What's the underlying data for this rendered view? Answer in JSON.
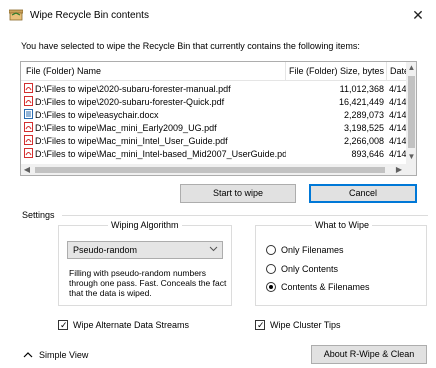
{
  "window": {
    "title": "Wipe Recycle Bin contents",
    "close_glyph": "✕"
  },
  "intro_text": "You have selected to wipe the Recycle Bin that currently contains the following items:",
  "list": {
    "columns": [
      "File (Folder) Name",
      "File (Folder) Size, bytes",
      "Date ."
    ],
    "rows": [
      {
        "name": "D:\\Files to wipe\\2020-subaru-forester-manual.pdf",
        "size": "11,012,368",
        "date": "4/14",
        "icon": "pdf-file-icon"
      },
      {
        "name": "D:\\Files to wipe\\2020-subaru-forester-Quick.pdf",
        "size": "16,421,449",
        "date": "4/14",
        "icon": "pdf-file-icon"
      },
      {
        "name": "D:\\Files to wipe\\easychair.docx",
        "size": "2,289,073",
        "date": "4/14",
        "icon": "docx-file-icon"
      },
      {
        "name": "D:\\Files to wipe\\Mac_mini_Early2009_UG.pdf",
        "size": "3,198,525",
        "date": "4/14",
        "icon": "pdf-file-icon"
      },
      {
        "name": "D:\\Files to wipe\\Mac_mini_Intel_User_Guide.pdf",
        "size": "2,266,008",
        "date": "4/14",
        "icon": "pdf-file-icon"
      },
      {
        "name": "D:\\Files to wipe\\Mac_mini_Intel-based_Mid2007_UserGuide.pdf",
        "size": "893,646",
        "date": "4/14",
        "icon": "pdf-file-icon"
      }
    ]
  },
  "buttons": {
    "start": "Start to wipe",
    "cancel": "Cancel",
    "about": "About R-Wipe & Clean"
  },
  "settings": {
    "label": "Settings",
    "wiping_algorithm": {
      "title": "Wiping Algorithm",
      "selected": "Pseudo-random",
      "description": "Filling with pseudo-random numbers through one pass. Fast. Conceals the fact that the data is wiped."
    },
    "what_to_wipe": {
      "title": "What to Wipe",
      "options": [
        "Only Filenames",
        "Only Contents",
        "Contents & Filenames"
      ],
      "selected_index": 2
    },
    "checkboxes": {
      "alternate_streams": {
        "label": "Wipe Alternate Data Streams",
        "checked": true
      },
      "cluster_tips": {
        "label": "Wipe Cluster Tips",
        "checked": true
      }
    }
  },
  "simple_view": "Simple View",
  "colors": {
    "accent_border": "#0078d7",
    "pdf_red": "#d32f2f",
    "docx_blue": "#2b6cb0"
  }
}
